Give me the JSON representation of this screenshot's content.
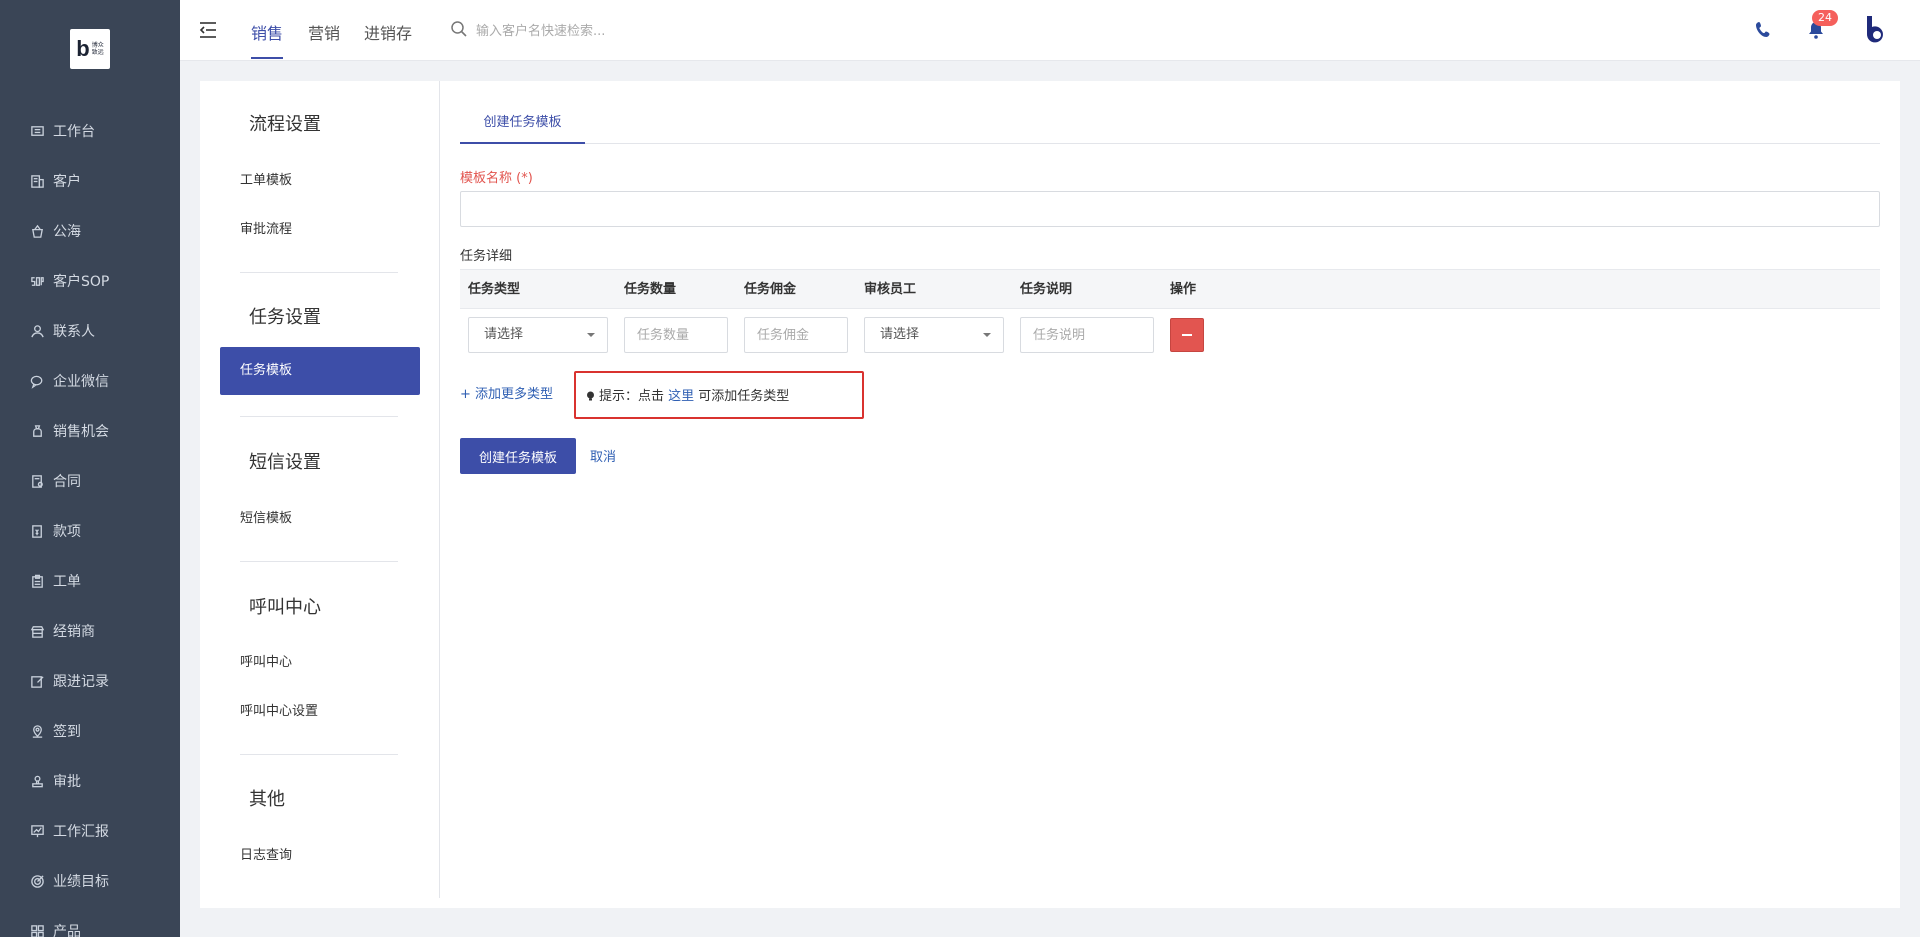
{
  "brand": {
    "logo_letter": "b",
    "logo_text_line1": "博众",
    "logo_text_line2": "致远"
  },
  "sidebar": {
    "items": [
      {
        "label": "工作台",
        "icon": "monitor-icon"
      },
      {
        "label": "客户",
        "icon": "building-icon"
      },
      {
        "label": "公海",
        "icon": "basket-icon"
      },
      {
        "label": "客户SOP",
        "icon": "sop-icon"
      },
      {
        "label": "联系人",
        "icon": "person-icon"
      },
      {
        "label": "企业微信",
        "icon": "chat-icon"
      },
      {
        "label": "销售机会",
        "icon": "moneybag-icon"
      },
      {
        "label": "合同",
        "icon": "contract-icon"
      },
      {
        "label": "款项",
        "icon": "payment-icon"
      },
      {
        "label": "工单",
        "icon": "clipboard-icon"
      },
      {
        "label": "经销商",
        "icon": "store-icon"
      },
      {
        "label": "跟进记录",
        "icon": "edit-icon"
      },
      {
        "label": "签到",
        "icon": "location-icon"
      },
      {
        "label": "审批",
        "icon": "stamp-icon"
      },
      {
        "label": "工作汇报",
        "icon": "report-icon"
      },
      {
        "label": "业绩目标",
        "icon": "target-icon"
      },
      {
        "label": "产品",
        "icon": "grid-icon"
      }
    ]
  },
  "topbar": {
    "tabs": [
      "销售",
      "营销",
      "进销存"
    ],
    "active_tab": "销售",
    "search_placeholder": "输入客户名快速检索...",
    "notification_count": "24"
  },
  "settings_nav": {
    "groups": [
      {
        "title": "流程设置",
        "items": [
          "工单模板",
          "审批流程"
        ]
      },
      {
        "title": "任务设置",
        "items": [
          "任务模板"
        ]
      },
      {
        "title": "短信设置",
        "items": [
          "短信模板"
        ]
      },
      {
        "title": "呼叫中心",
        "items": [
          "呼叫中心",
          "呼叫中心设置"
        ]
      },
      {
        "title": "其他",
        "items": [
          "日志查询"
        ]
      }
    ],
    "active_item": "任务模板"
  },
  "main": {
    "tab_label": "创建任务模板",
    "name_label": "模板名称 (*)",
    "name_value": "",
    "details_label": "任务详细",
    "table": {
      "columns": [
        "任务类型",
        "任务数量",
        "任务佣金",
        "审核员工",
        "任务说明",
        "操作"
      ],
      "row": {
        "task_type": "请选择",
        "task_quantity_placeholder": "任务数量",
        "task_commission_placeholder": "任务佣金",
        "reviewer": "请选择",
        "task_description_placeholder": "任务说明"
      }
    },
    "add_more_label": "+ 添加更多类型",
    "hint": {
      "prefix": "提示：点击 ",
      "link": "这里",
      "suffix": " 可添加任务类型"
    },
    "create_button": "创建任务模板",
    "cancel_link": "取消"
  },
  "colors": {
    "sidebar_bg": "#3a4556",
    "accent": "#3d4ea8",
    "danger": "#e25550",
    "link": "#2f5fb3",
    "required_label": "#e2554f",
    "badge": "#f5605c"
  }
}
